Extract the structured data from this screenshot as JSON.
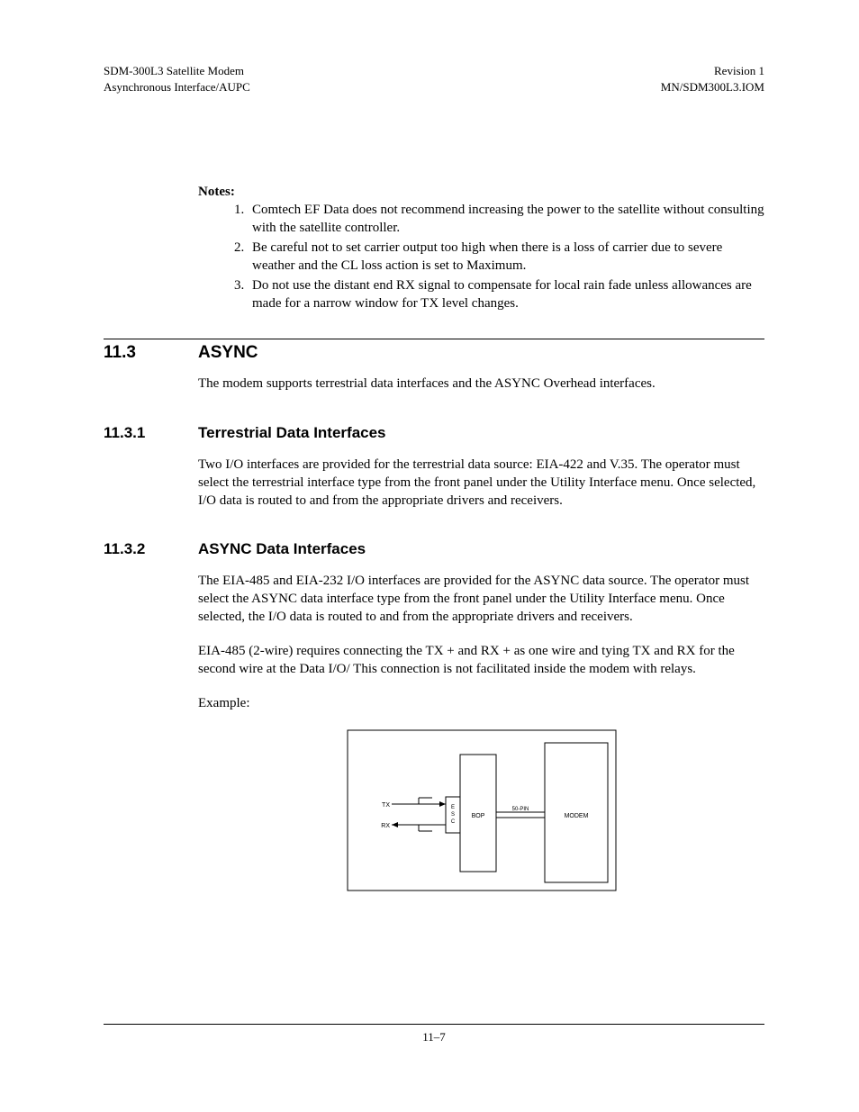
{
  "header": {
    "left_line1": "SDM-300L3 Satellite Modem",
    "left_line2": "Asynchronous Interface/AUPC",
    "right_line1": "Revision 1",
    "right_line2": "MN/SDM300L3.IOM"
  },
  "notes": {
    "label": "Notes:",
    "items": [
      "Comtech EF Data does not recommend increasing the power to the satellite without consulting with the satellite controller.",
      "Be careful not to set carrier output too high when there is a loss of carrier due to severe weather and the CL loss action is set to Maximum.",
      "Do not use the distant end RX signal to compensate for local rain fade unless allowances are made for a narrow window for TX level changes."
    ]
  },
  "s113": {
    "num": "11.3",
    "title": "ASYNC",
    "para": "The modem supports terrestrial data interfaces and the ASYNC Overhead interfaces."
  },
  "s1131": {
    "num": "11.3.1",
    "title": "Terrestrial Data Interfaces",
    "para": "Two I/O interfaces are provided for the terrestrial data source: EIA-422 and V.35. The operator must select the terrestrial interface type from the front panel under the Utility Interface menu. Once selected, I/O data is routed to and from the appropriate drivers and receivers."
  },
  "s1132": {
    "num": "11.3.2",
    "title": "ASYNC Data Interfaces",
    "para1": "The EIA-485 and EIA-232 I/O interfaces are provided for the ASYNC data source. The operator must select the ASYNC data interface type from the front panel under the Utility Interface menu. Once selected, the I/O data is routed to and from the appropriate drivers and receivers.",
    "para2": "EIA-485 (2-wire) requires connecting the TX + and RX + as one wire and tying TX  and RX  for the second wire at the Data I/O/ This connection is not facilitated inside the modem with relays.",
    "example_label": "Example:"
  },
  "diagram": {
    "tx": "TX",
    "rx": "RX",
    "esc": "E\nS\nC",
    "bop": "BOP",
    "pin": "50-PIN",
    "modem": "MODEM"
  },
  "footer": {
    "page": "11–7"
  }
}
